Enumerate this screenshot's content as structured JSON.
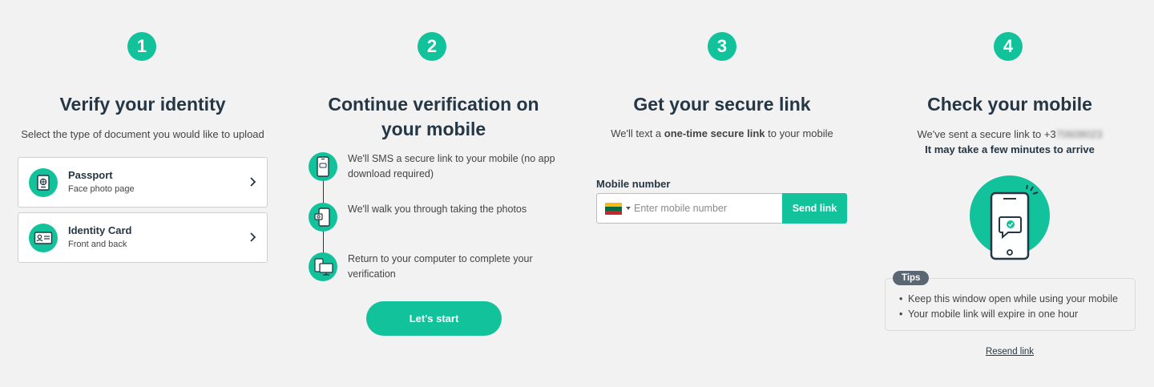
{
  "colors": {
    "accent": "#12c29a",
    "heading": "#253645",
    "tips_badge": "#5a6672"
  },
  "step1": {
    "number": "1",
    "title": "Verify your identity",
    "subtitle": "Select the type of document you would like to upload",
    "documents": [
      {
        "name": "Passport",
        "desc": "Face photo page",
        "icon": "passport-icon"
      },
      {
        "name": "Identity Card",
        "desc": "Front and back",
        "icon": "id-card-icon"
      }
    ]
  },
  "step2": {
    "number": "2",
    "title_line1": "Continue verification on",
    "title_line2": "your mobile",
    "items": [
      {
        "text": "We'll SMS a secure link to your mobile (no app download required)",
        "icon": "phone-sms-icon"
      },
      {
        "text": "We'll walk you through taking the photos",
        "icon": "phone-camera-icon"
      },
      {
        "text": "Return to your computer to complete your verification",
        "icon": "computer-icon"
      }
    ],
    "button": "Let's start"
  },
  "step3": {
    "number": "3",
    "title": "Get your secure link",
    "subtitle_pre": "We'll text a ",
    "subtitle_bold": "one-time secure link",
    "subtitle_post": " to your mobile",
    "mobile_label": "Mobile number",
    "country_flag": "lithuania-flag",
    "placeholder": "Enter mobile number",
    "send_button": "Send link"
  },
  "step4": {
    "number": "4",
    "title": "Check your mobile",
    "sent_text": "We've sent a secure link to +3",
    "sent_number_masked": "70608023",
    "wait_text": "It may take a few minutes to arrive",
    "tips_label": "Tips",
    "tips": [
      "Keep this window open while using your mobile",
      "Your mobile link will expire in one hour"
    ],
    "resend": "Resend link"
  }
}
